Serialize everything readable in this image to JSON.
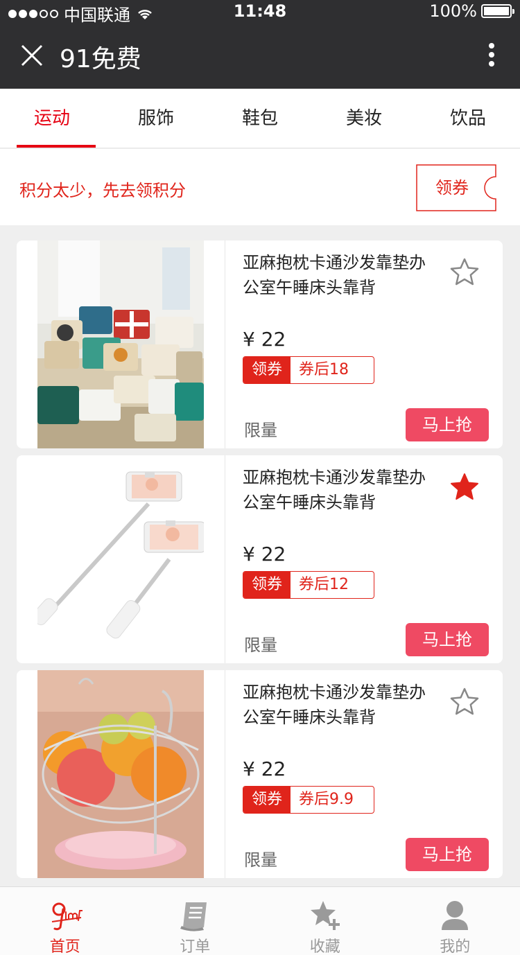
{
  "status": {
    "carrier": "中国联通",
    "time": "11:48",
    "battery": "100%"
  },
  "nav": {
    "title": "91免费"
  },
  "tabs": [
    {
      "label": "运动",
      "active": true
    },
    {
      "label": "服饰",
      "active": false
    },
    {
      "label": "鞋包",
      "active": false
    },
    {
      "label": "美妆",
      "active": false
    },
    {
      "label": "饮品",
      "active": false
    }
  ],
  "banner": {
    "message": "积分太少，先去领积分",
    "coupon_label": "领券"
  },
  "products": [
    {
      "name": "亚麻抱枕卡通沙发靠垫办公室午睡床头靠背",
      "price": "¥ 22",
      "tag_left": "领券",
      "tag_right": "券后18",
      "limit": "限量",
      "buy": "马上抢",
      "favorited": false,
      "image": "pillows"
    },
    {
      "name": "亚麻抱枕卡通沙发靠垫办公室午睡床头靠背",
      "price": "¥ 22",
      "tag_left": "领券",
      "tag_right": "券后12",
      "limit": "限量",
      "buy": "马上抢",
      "favorited": true,
      "image": "selfie-sticks"
    },
    {
      "name": "亚麻抱枕卡通沙发靠垫办公室午睡床头靠背",
      "price": "¥ 22",
      "tag_left": "领券",
      "tag_right": "券后9.9",
      "limit": "限量",
      "buy": "马上抢",
      "favorited": false,
      "image": "fruit-basket"
    }
  ],
  "tabbar": [
    {
      "label": "首页",
      "icon": "home-logo-icon",
      "active": true
    },
    {
      "label": "订单",
      "icon": "order-icon",
      "active": false
    },
    {
      "label": "收藏",
      "icon": "favorites-icon",
      "active": false
    },
    {
      "label": "我的",
      "icon": "profile-icon",
      "active": false
    }
  ],
  "colors": {
    "accent": "#e0241b",
    "buy_button": "#ef4a63",
    "topbar": "#2f2f31"
  }
}
